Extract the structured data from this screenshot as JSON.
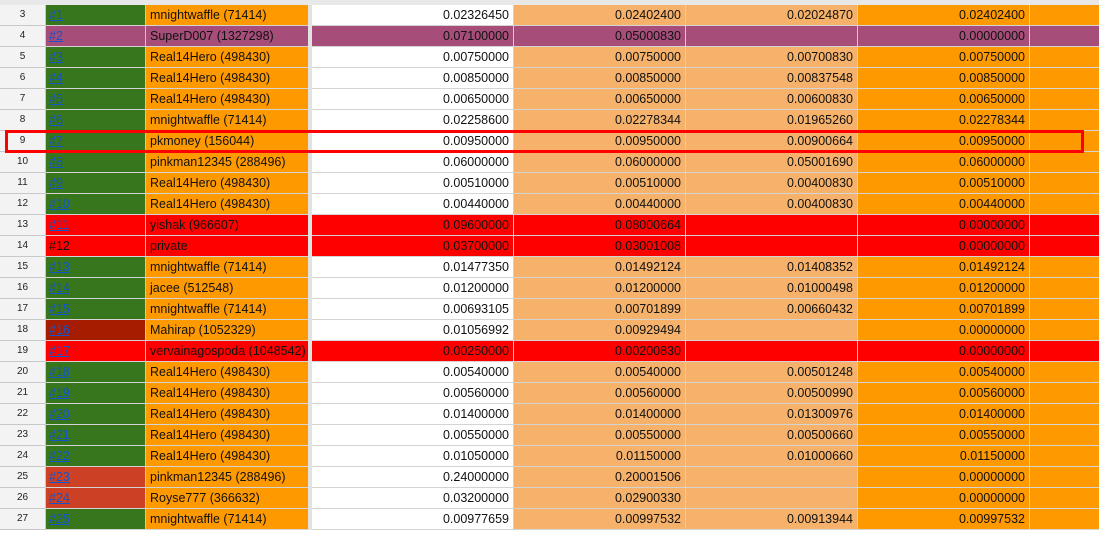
{
  "colors": {
    "green": "#38761d",
    "purple": "#a64d79",
    "red": "#ff0000",
    "darkred": "#a61c00",
    "coral": "#cc4125",
    "orange": "#ff9900",
    "peach": "#f6b26b",
    "white": "#ffffff",
    "highlight_box": "#ff0000"
  },
  "rows": [
    {
      "num": "3",
      "id": "#1",
      "link": true,
      "idc": "green",
      "name": "mnightwaffle (71414)",
      "nc": "orange",
      "v1": "0.02326450",
      "c1": "white",
      "v2": "0.02402400",
      "c2": "peach",
      "v3": "0.02024870",
      "c3": "peach",
      "v4": "0.02402400",
      "c4": "orange"
    },
    {
      "num": "4",
      "id": "#2",
      "link": true,
      "idc": "purple",
      "name": "SuperD007 (1327298)",
      "nc": "purple",
      "v1": "0.07100000",
      "c1": "purple",
      "v2": "0.05000830",
      "c2": "purple",
      "v3": "",
      "c3": "purple",
      "v4": "0.00000000",
      "c4": "purple"
    },
    {
      "num": "5",
      "id": "#3",
      "link": true,
      "idc": "green",
      "name": "Real14Hero (498430)",
      "nc": "orange",
      "v1": "0.00750000",
      "c1": "white",
      "v2": "0.00750000",
      "c2": "peach",
      "v3": "0.00700830",
      "c3": "peach",
      "v4": "0.00750000",
      "c4": "orange"
    },
    {
      "num": "6",
      "id": "#4",
      "link": true,
      "idc": "green",
      "name": "Real14Hero (498430)",
      "nc": "orange",
      "v1": "0.00850000",
      "c1": "white",
      "v2": "0.00850000",
      "c2": "peach",
      "v3": "0.00837548",
      "c3": "peach",
      "v4": "0.00850000",
      "c4": "orange"
    },
    {
      "num": "7",
      "id": "#5",
      "link": true,
      "idc": "green",
      "name": "Real14Hero (498430)",
      "nc": "orange",
      "v1": "0.00650000",
      "c1": "white",
      "v2": "0.00650000",
      "c2": "peach",
      "v3": "0.00600830",
      "c3": "peach",
      "v4": "0.00650000",
      "c4": "orange"
    },
    {
      "num": "8",
      "id": "#6",
      "link": true,
      "idc": "green",
      "name": "mnightwaffle (71414)",
      "nc": "orange",
      "v1": "0.02258600",
      "c1": "white",
      "v2": "0.02278344",
      "c2": "peach",
      "v3": "0.01965260",
      "c3": "peach",
      "v4": "0.02278344",
      "c4": "orange"
    },
    {
      "num": "9",
      "id": "#7",
      "link": true,
      "idc": "green",
      "name": "pkmoney (156044)",
      "nc": "orange",
      "v1": "0.00950000",
      "c1": "white",
      "v2": "0.00950000",
      "c2": "peach",
      "v3": "0.00900664",
      "c3": "peach",
      "v4": "0.00950000",
      "c4": "orange"
    },
    {
      "num": "10",
      "id": "#8",
      "link": true,
      "idc": "green",
      "name": "pinkman12345 (288496)",
      "nc": "orange",
      "v1": "0.06000000",
      "c1": "white",
      "v2": "0.06000000",
      "c2": "peach",
      "v3": "0.05001690",
      "c3": "peach",
      "v4": "0.06000000",
      "c4": "orange"
    },
    {
      "num": "11",
      "id": "#9",
      "link": true,
      "idc": "green",
      "name": "Real14Hero (498430)",
      "nc": "orange",
      "v1": "0.00510000",
      "c1": "white",
      "v2": "0.00510000",
      "c2": "peach",
      "v3": "0.00400830",
      "c3": "peach",
      "v4": "0.00510000",
      "c4": "orange"
    },
    {
      "num": "12",
      "id": "#10",
      "link": true,
      "idc": "green",
      "name": "Real14Hero (498430)",
      "nc": "orange",
      "v1": "0.00440000",
      "c1": "white",
      "v2": "0.00440000",
      "c2": "peach",
      "v3": "0.00400830",
      "c3": "peach",
      "v4": "0.00440000",
      "c4": "orange"
    },
    {
      "num": "13",
      "id": "#11",
      "link": true,
      "idc": "red",
      "name": "yishak (966607)",
      "nc": "red",
      "v1": "0.09600000",
      "c1": "red",
      "v2": "0.08000664",
      "c2": "red",
      "v3": "",
      "c3": "red",
      "v4": "0.00000000",
      "c4": "red"
    },
    {
      "num": "14",
      "id": "#12",
      "link": false,
      "idc": "red",
      "name": "private",
      "nc": "red",
      "v1": "0.03700000",
      "c1": "red",
      "v2": "0.03001008",
      "c2": "red",
      "v3": "",
      "c3": "red",
      "v4": "0.00000000",
      "c4": "red"
    },
    {
      "num": "15",
      "id": "#13",
      "link": true,
      "idc": "green",
      "name": "mnightwaffle (71414)",
      "nc": "orange",
      "v1": "0.01477350",
      "c1": "white",
      "v2": "0.01492124",
      "c2": "peach",
      "v3": "0.01408352",
      "c3": "peach",
      "v4": "0.01492124",
      "c4": "orange"
    },
    {
      "num": "16",
      "id": "#14",
      "link": true,
      "idc": "green",
      "name": "jacee (512548)",
      "nc": "orange",
      "v1": "0.01200000",
      "c1": "white",
      "v2": "0.01200000",
      "c2": "peach",
      "v3": "0.01000498",
      "c3": "peach",
      "v4": "0.01200000",
      "c4": "orange"
    },
    {
      "num": "17",
      "id": "#15",
      "link": true,
      "idc": "green",
      "name": "mnightwaffle (71414)",
      "nc": "orange",
      "v1": "0.00693105",
      "c1": "white",
      "v2": "0.00701899",
      "c2": "peach",
      "v3": "0.00660432",
      "c3": "peach",
      "v4": "0.00701899",
      "c4": "orange"
    },
    {
      "num": "18",
      "id": "#16",
      "link": true,
      "idc": "darkred",
      "name": "Mahirap (1052329)",
      "nc": "orange",
      "v1": "0.01056992",
      "c1": "white",
      "v2": "0.00929494",
      "c2": "peach",
      "v3": "",
      "c3": "peach",
      "v4": "0.00000000",
      "c4": "orange"
    },
    {
      "num": "19",
      "id": "#17",
      "link": true,
      "idc": "red",
      "name": "vervainagospoda (1048542)",
      "nc": "red",
      "v1": "0.00250000",
      "c1": "red",
      "v2": "0.00200830",
      "c2": "red",
      "v3": "",
      "c3": "red",
      "v4": "0.00000000",
      "c4": "red"
    },
    {
      "num": "20",
      "id": "#18",
      "link": true,
      "idc": "green",
      "name": "Real14Hero (498430)",
      "nc": "orange",
      "v1": "0.00540000",
      "c1": "white",
      "v2": "0.00540000",
      "c2": "peach",
      "v3": "0.00501248",
      "c3": "peach",
      "v4": "0.00540000",
      "c4": "orange"
    },
    {
      "num": "21",
      "id": "#19",
      "link": true,
      "idc": "green",
      "name": "Real14Hero (498430)",
      "nc": "orange",
      "v1": "0.00560000",
      "c1": "white",
      "v2": "0.00560000",
      "c2": "peach",
      "v3": "0.00500990",
      "c3": "peach",
      "v4": "0.00560000",
      "c4": "orange"
    },
    {
      "num": "22",
      "id": "#20",
      "link": true,
      "idc": "green",
      "name": "Real14Hero (498430)",
      "nc": "orange",
      "v1": "0.01400000",
      "c1": "white",
      "v2": "0.01400000",
      "c2": "peach",
      "v3": "0.01300976",
      "c3": "peach",
      "v4": "0.01400000",
      "c4": "orange"
    },
    {
      "num": "23",
      "id": "#21",
      "link": true,
      "idc": "green",
      "name": "Real14Hero (498430)",
      "nc": "orange",
      "v1": "0.00550000",
      "c1": "white",
      "v2": "0.00550000",
      "c2": "peach",
      "v3": "0.00500660",
      "c3": "peach",
      "v4": "0.00550000",
      "c4": "orange"
    },
    {
      "num": "24",
      "id": "#22",
      "link": true,
      "idc": "green",
      "name": "Real14Hero (498430)",
      "nc": "orange",
      "v1": "0.01050000",
      "c1": "white",
      "v2": "0.01150000",
      "c2": "peach",
      "v3": "0.01000660",
      "c3": "peach",
      "v4": "0.01150000",
      "c4": "orange"
    },
    {
      "num": "25",
      "id": "#23",
      "link": true,
      "idc": "coral",
      "name": "pinkman12345 (288496)",
      "nc": "orange",
      "v1": "0.24000000",
      "c1": "white",
      "v2": "0.20001506",
      "c2": "peach",
      "v3": "",
      "c3": "peach",
      "v4": "0.00000000",
      "c4": "orange"
    },
    {
      "num": "26",
      "id": "#24",
      "link": true,
      "idc": "coral",
      "name": "Royse777 (366632)",
      "nc": "orange",
      "v1": "0.03200000",
      "c1": "white",
      "v2": "0.02900330",
      "c2": "peach",
      "v3": "",
      "c3": "peach",
      "v4": "0.00000000",
      "c4": "orange"
    },
    {
      "num": "27",
      "id": "#25",
      "link": true,
      "idc": "green",
      "name": "mnightwaffle (71414)",
      "nc": "orange",
      "v1": "0.00977659",
      "c1": "white",
      "v2": "0.00997532",
      "c2": "peach",
      "v3": "0.00913944",
      "c3": "peach",
      "v4": "0.00997532",
      "c4": "orange"
    }
  ]
}
